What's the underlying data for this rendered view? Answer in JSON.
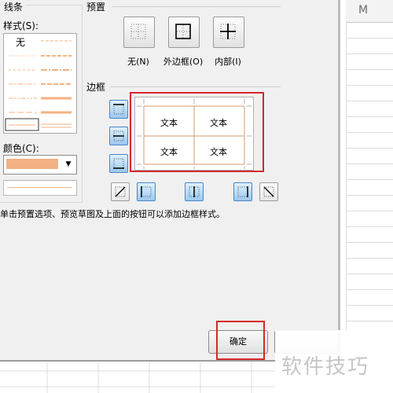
{
  "sheet": {
    "column_header": "M"
  },
  "line_group": {
    "title": "线条",
    "style_label": "样式(S):",
    "none_label": "无",
    "color_label": "颜色(C):",
    "selected_color": "#f4b183"
  },
  "presets": {
    "title": "预置",
    "items": [
      {
        "label": "无(N)",
        "icon": "no-border-icon"
      },
      {
        "label": "外边框(O)",
        "icon": "outline-border-icon"
      },
      {
        "label": "内部(I)",
        "icon": "inside-border-icon"
      }
    ]
  },
  "border": {
    "title": "边框",
    "cell_texts": [
      "文本",
      "文本",
      "文本",
      "文本"
    ],
    "hint": "单击预置选项、预览草图及上面的按钮可以添加边框样式。"
  },
  "buttons": {
    "ok": "确定"
  },
  "watermark": "软件技巧",
  "colors": {
    "highlight": "#d62828",
    "accent_border": "#f4b183"
  }
}
